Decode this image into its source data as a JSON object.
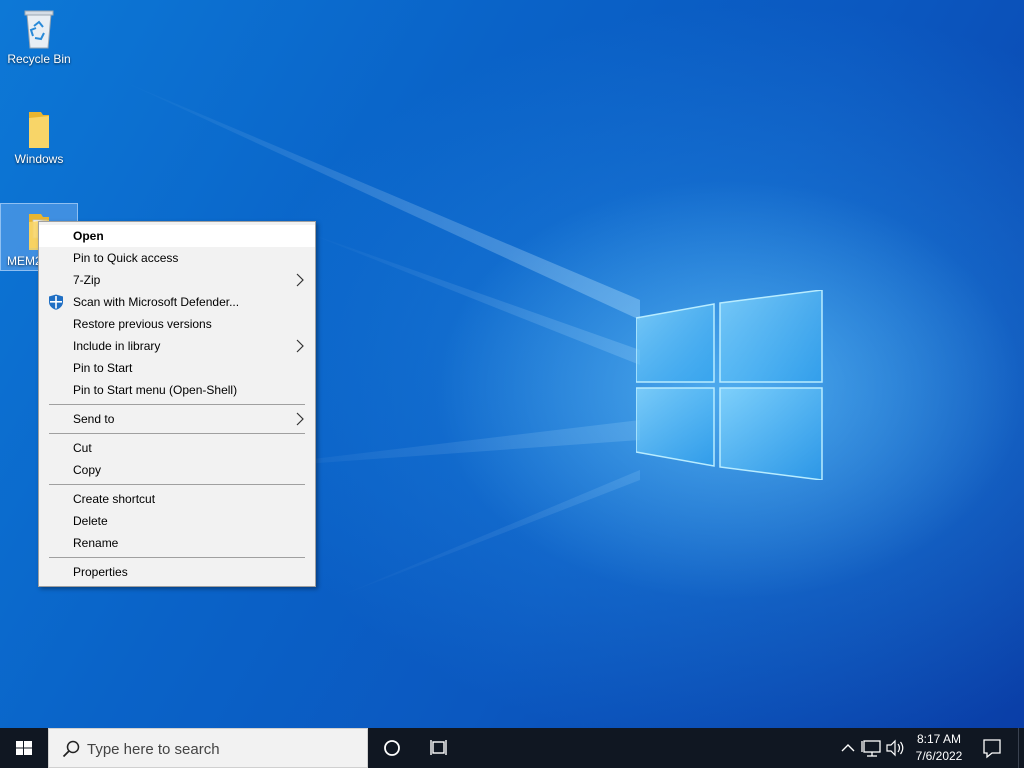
{
  "desktop": {
    "icons": [
      {
        "label": "Recycle Bin",
        "icon": "recycle-bin-icon"
      },
      {
        "label": "Windows",
        "icon": "folder-icon"
      },
      {
        "label": "MEM2",
        "icon": "folder-icon"
      }
    ]
  },
  "context_menu": {
    "items": [
      {
        "label": "Open",
        "bold": true,
        "submenu": false
      },
      {
        "label": "Pin to Quick access",
        "submenu": false
      },
      {
        "label": "7-Zip",
        "submenu": true
      },
      {
        "label": "Scan with Microsoft Defender...",
        "submenu": false,
        "icon": "defender-shield-icon"
      },
      {
        "label": "Restore previous versions",
        "submenu": false
      },
      {
        "label": "Include in library",
        "submenu": true
      },
      {
        "label": "Pin to Start",
        "submenu": false
      },
      {
        "label": "Pin to Start menu (Open-Shell)",
        "submenu": false
      },
      {
        "label": "Send to",
        "submenu": true
      },
      {
        "label": "Cut",
        "submenu": false
      },
      {
        "label": "Copy",
        "submenu": false
      },
      {
        "label": "Create shortcut",
        "submenu": false
      },
      {
        "label": "Delete",
        "submenu": false
      },
      {
        "label": "Rename",
        "submenu": false
      },
      {
        "label": "Properties",
        "submenu": false
      }
    ]
  },
  "taskbar": {
    "search_placeholder": "Type here to search",
    "clock_time": "8:17 AM",
    "clock_date": "7/6/2022"
  },
  "colors": {
    "taskbar_bg": "#101722",
    "menu_bg": "#f2f2f2",
    "accent": "#0a63c8"
  }
}
